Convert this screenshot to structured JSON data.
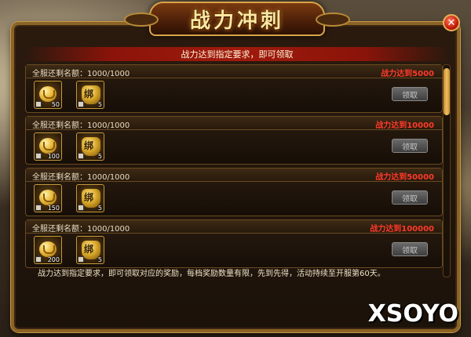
{
  "window": {
    "title": "战力冲刺",
    "notice": "战力达到指定要求，即可领取",
    "close_icon": "close-icon",
    "footer": "战力达到指定要求，即可领取对应的奖励，每档奖励数量有限，先到先得，活动持续至开服第60天。"
  },
  "entries": [
    {
      "quota": "全服还剩名额：1000/1000",
      "target": "战力达到5000",
      "items": [
        {
          "icon": "gold-coin-icon",
          "count": "50"
        },
        {
          "icon": "gift-bag-icon",
          "char": "绑",
          "count": "5"
        }
      ],
      "button": "领取"
    },
    {
      "quota": "全服还剩名额：1000/1000",
      "target": "战力达到10000",
      "items": [
        {
          "icon": "gold-coin-icon",
          "count": "100"
        },
        {
          "icon": "gift-bag-icon",
          "char": "绑",
          "count": "5"
        }
      ],
      "button": "领取"
    },
    {
      "quota": "全服还剩名额：1000/1000",
      "target": "战力达到50000",
      "items": [
        {
          "icon": "gold-coin-icon",
          "count": "150"
        },
        {
          "icon": "gift-bag-icon",
          "char": "绑",
          "count": "5"
        }
      ],
      "button": "领取"
    },
    {
      "quota": "全服还剩名额：1000/1000",
      "target": "战力达到100000",
      "items": [
        {
          "icon": "gold-coin-icon",
          "count": "200"
        },
        {
          "icon": "gift-bag-icon",
          "char": "绑",
          "count": "5"
        }
      ],
      "button": "领取"
    }
  ],
  "watermark": "XSOYO",
  "colors": {
    "frame_gold": "#c99a48",
    "target_red": "#ff3a2a",
    "notice_red": "#a01a0c",
    "button_gray": "#4e4e4e"
  }
}
